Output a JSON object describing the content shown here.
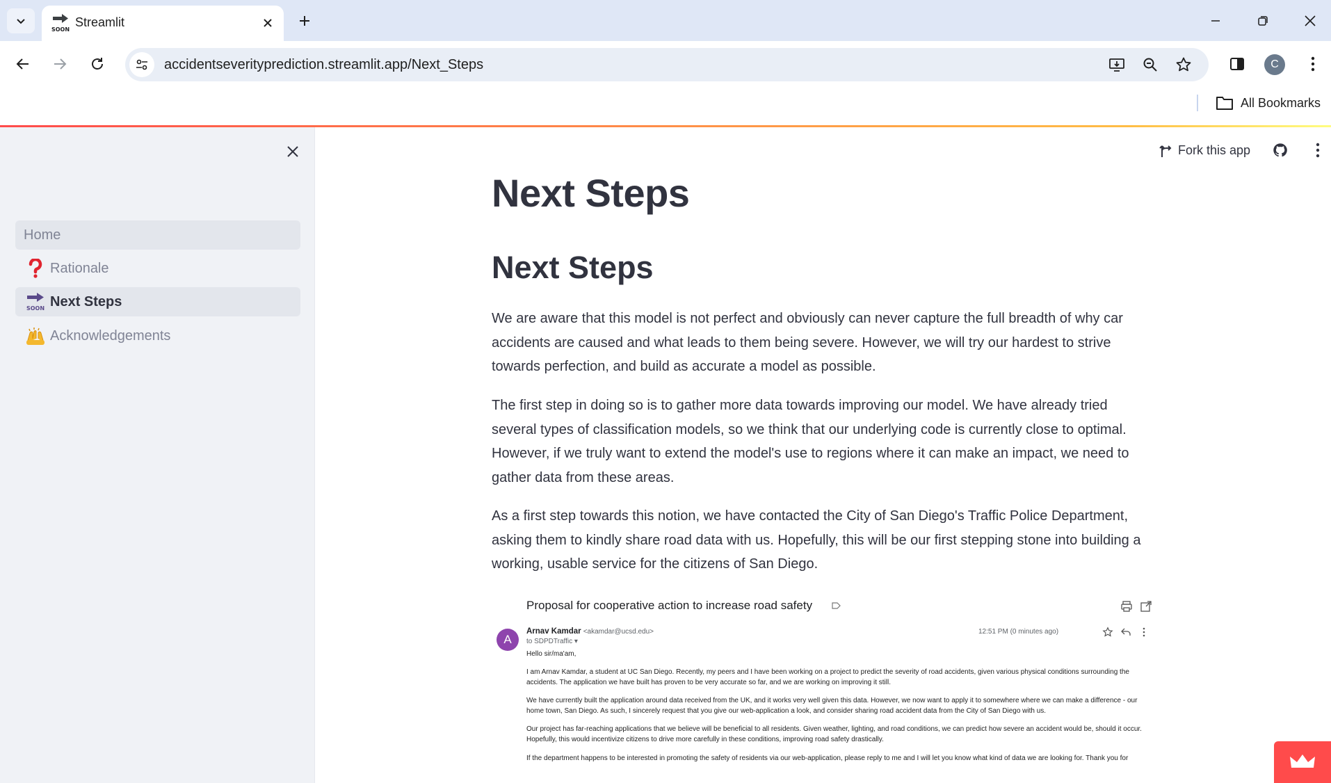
{
  "browser": {
    "tab_title": "Streamlit",
    "url": "accidentseverityprediction.streamlit.app/Next_Steps",
    "bookmarks_label": "All Bookmarks",
    "profile_initial": "C"
  },
  "app": {
    "header": {
      "fork_label": "Fork this app"
    },
    "sidebar": {
      "items": [
        {
          "label": "Home",
          "icon": ""
        },
        {
          "label": "Rationale",
          "icon": "question-mark-icon"
        },
        {
          "label": "Next Steps",
          "icon": "soon-arrow-icon"
        },
        {
          "label": "Acknowledgements",
          "icon": "raising-hands-icon"
        }
      ]
    },
    "main": {
      "title": "Next Steps",
      "section_heading": "Next Steps",
      "paragraphs": [
        "We are aware that this model is not perfect and obviously can never capture the full breadth of why car accidents are caused and what leads to them being severe. However, we will try our hardest to strive towards perfection, and build as accurate a model as possible.",
        "The first step in doing so is to gather more data towards improving our model. We have already tried several types of classification models, so we think that our underlying code is currently close to optimal. However, if we truly want to extend the model's use to regions where it can make an impact, we need to gather data from these areas.",
        "As a first step towards this notion, we have contacted the City of San Diego's Traffic Police Department, asking them to kindly share road data with us. Hopefully, this will be our first stepping stone into building a working, usable service for the citizens of San Diego."
      ]
    },
    "email_image": {
      "subject": "Proposal for cooperative action to increase road safety",
      "avatar_initial": "A",
      "sender_name": "Arnav Kamdar",
      "sender_email": "<akamdar@ucsd.edu>",
      "to": "to SDPDTraffic",
      "time": "12:51 PM (0 minutes ago)",
      "greeting": "Hello sir/ma'am,",
      "body": [
        "I am Arnav Kamdar, a student at UC San Diego. Recently, my peers and I have been working on a project to predict the severity of road accidents, given various physical conditions surrounding the accidents. The application we have built has proven to be very accurate so far, and we are working on improving it still.",
        "We have currently built the application around data received from the UK, and it works very well given this data. However, we now want to apply it to somewhere where we can make a difference - our home town, San Diego. As such, I sincerely request that you give our web-application a look, and consider sharing road accident data from the City of San Diego with us.",
        "Our project has far-reaching applications that we believe will be beneficial to all residents. Given weather, lighting, and road conditions, we can predict how severe an accident would be, should it occur. Hopefully, this would incentivize citizens to drive more carefully in these conditions, improving road safety drastically.",
        "If the department happens to be interested in promoting the safety of residents via our web-application, please reply to me and I will let you know what kind of data we are looking for. Thank you for"
      ]
    }
  }
}
